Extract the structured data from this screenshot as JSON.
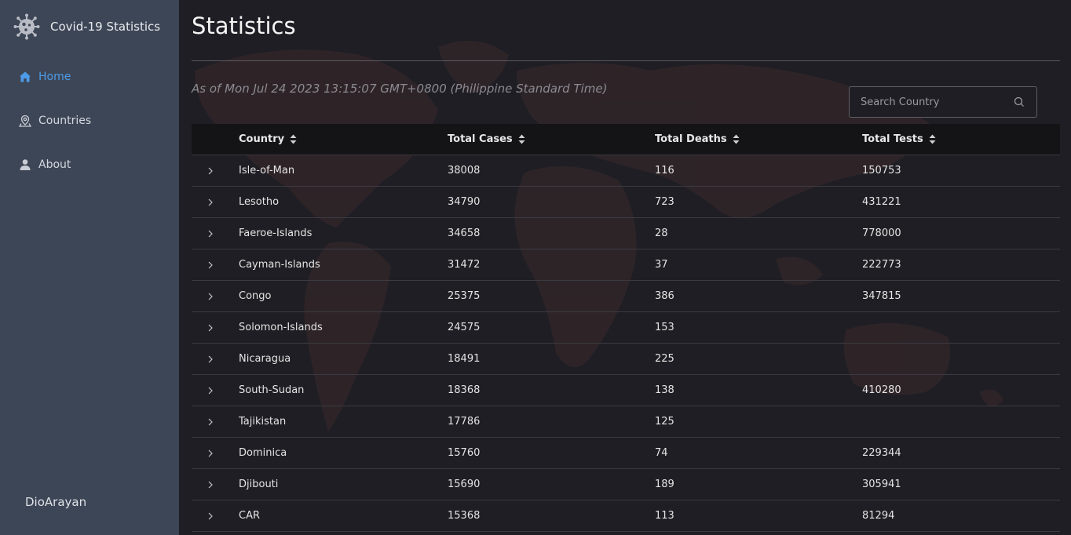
{
  "app": {
    "title": "Covid-19 Statistics",
    "accent_color": "#4d9be8",
    "logo_icon": "virus-icon"
  },
  "sidebar": {
    "items": [
      {
        "label": "Home",
        "icon": "home-icon",
        "active": true
      },
      {
        "label": "Countries",
        "icon": "location-pin-icon",
        "active": false
      },
      {
        "label": "About",
        "icon": "user-icon",
        "active": false
      }
    ],
    "footer": "DioArayan"
  },
  "main": {
    "title": "Statistics",
    "as_of": "As of Mon Jul 24 2023 13:15:07 GMT+0800 (Philippine Standard Time)",
    "search": {
      "placeholder": "Search Country",
      "value": ""
    }
  },
  "table": {
    "columns": [
      "Country",
      "Total Cases",
      "Total Deaths",
      "Total Tests"
    ],
    "rows": [
      {
        "country": "Isle-of-Man",
        "cases": "38008",
        "deaths": "116",
        "tests": "150753"
      },
      {
        "country": "Lesotho",
        "cases": "34790",
        "deaths": "723",
        "tests": "431221"
      },
      {
        "country": "Faeroe-Islands",
        "cases": "34658",
        "deaths": "28",
        "tests": "778000"
      },
      {
        "country": "Cayman-Islands",
        "cases": "31472",
        "deaths": "37",
        "tests": "222773"
      },
      {
        "country": "Congo",
        "cases": "25375",
        "deaths": "386",
        "tests": "347815"
      },
      {
        "country": "Solomon-Islands",
        "cases": "24575",
        "deaths": "153",
        "tests": ""
      },
      {
        "country": "Nicaragua",
        "cases": "18491",
        "deaths": "225",
        "tests": ""
      },
      {
        "country": "South-Sudan",
        "cases": "18368",
        "deaths": "138",
        "tests": "410280"
      },
      {
        "country": "Tajikistan",
        "cases": "17786",
        "deaths": "125",
        "tests": ""
      },
      {
        "country": "Dominica",
        "cases": "15760",
        "deaths": "74",
        "tests": "229344"
      },
      {
        "country": "Djibouti",
        "cases": "15690",
        "deaths": "189",
        "tests": "305941"
      },
      {
        "country": "CAR",
        "cases": "15368",
        "deaths": "113",
        "tests": "81294"
      }
    ]
  }
}
